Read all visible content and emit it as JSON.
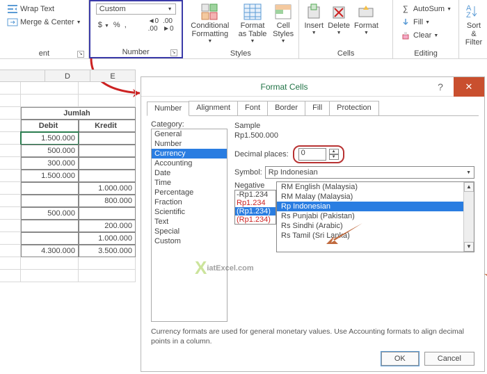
{
  "ribbon": {
    "wrap": "Wrap Text",
    "merge": "Merge & Center",
    "alignment_group": "ent",
    "number_group": "Number",
    "number_format": "Custom",
    "styles_group": "Styles",
    "cond": "Conditional Formatting",
    "fmt_tbl": "Format as Table",
    "cell_styles": "Cell Styles",
    "cells_group": "Cells",
    "insert": "Insert",
    "delete": "Delete",
    "format": "Format",
    "editing_group": "Editing",
    "autosum": "AutoSum",
    "fill": "Fill",
    "clear": "Clear",
    "sort": "Sort & Filter"
  },
  "sheet": {
    "colD": "D",
    "colE": "E",
    "head": "Jumlah",
    "debit": "Debit",
    "kredit": "Kredit",
    "rows": [
      [
        "1.500.000",
        ""
      ],
      [
        "500.000",
        ""
      ],
      [
        "300.000",
        ""
      ],
      [
        "1.500.000",
        ""
      ],
      [
        "",
        "1.000.000"
      ],
      [
        "",
        "800.000"
      ],
      [
        "500.000",
        ""
      ],
      [
        "",
        "200.000"
      ],
      [
        "",
        "1.000.000"
      ],
      [
        "4.300.000",
        "3.500.000"
      ]
    ]
  },
  "dialog": {
    "title": "Format Cells",
    "tabs": [
      "Number",
      "Alignment",
      "Font",
      "Border",
      "Fill",
      "Protection"
    ],
    "category_label": "Category:",
    "categories": [
      "General",
      "Number",
      "Currency",
      "Accounting",
      "Date",
      "Time",
      "Percentage",
      "Fraction",
      "Scientific",
      "Text",
      "Special",
      "Custom"
    ],
    "category_selected": "Currency",
    "sample_label": "Sample",
    "sample_value": "Rp1.500.000",
    "decimal_label": "Decimal places:",
    "decimal_value": "0",
    "symbol_label": "Symbol:",
    "symbol_value": "Rp Indonesian",
    "neg_label": "Negative",
    "neg_items": [
      "-Rp1.234",
      "Rp1.234",
      "(Rp1.234)",
      "(Rp1.234)"
    ],
    "curr_items": [
      "RM English (Malaysia)",
      "RM Malay (Malaysia)",
      "Rp Indonesian",
      "Rs Punjabi (Pakistan)",
      "Rs Sindhi (Arabic)",
      "Rs Tamil (Sri Lanka)"
    ],
    "curr_selected": "Rp Indonesian",
    "desc": "Currency formats are used for general monetary values.  Use Accounting formats to align decimal points in a column.",
    "ok": "OK",
    "cancel": "Cancel"
  },
  "watermark": "iatExcel.com"
}
